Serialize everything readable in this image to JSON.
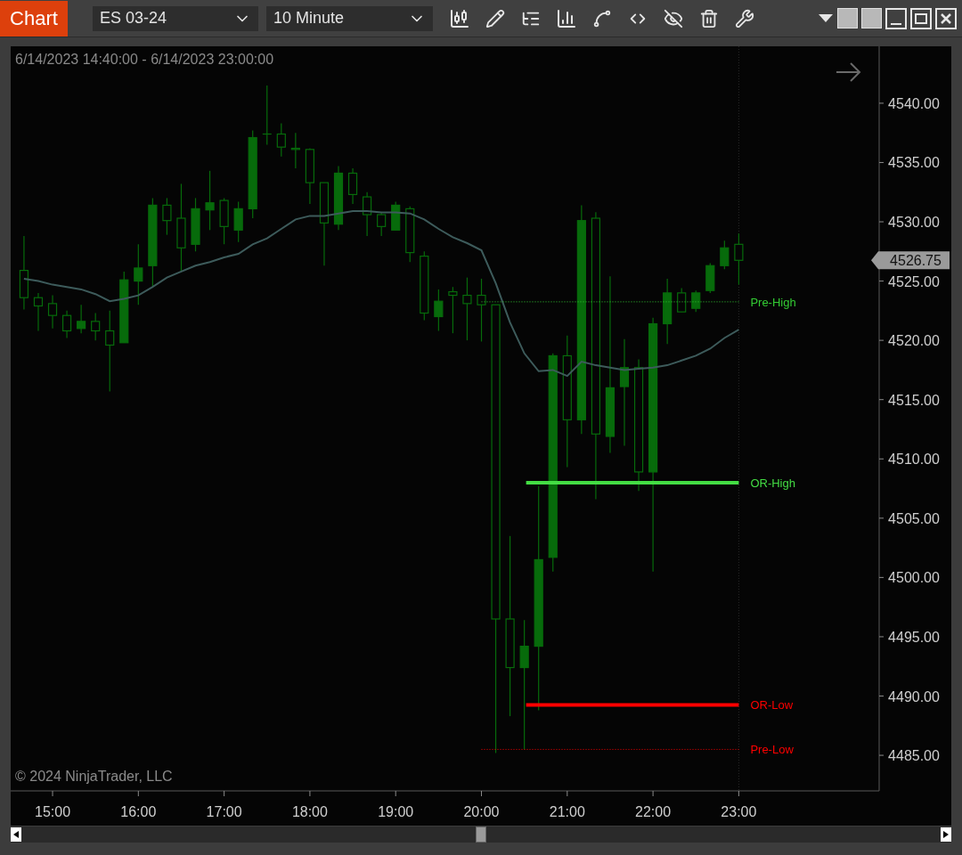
{
  "toolbar": {
    "title": "Chart",
    "instrument": "ES 03-24",
    "interval": "10 Minute"
  },
  "chart": {
    "date_range": "6/14/2023 14:40:00 - 6/14/2023 23:00:00",
    "copyright": "© 2024 NinjaTrader, LLC",
    "last_price": "4526.75",
    "chart_data": {
      "type": "candlestick",
      "x": [
        14.6667,
        14.8333,
        15,
        15.1667,
        15.3333,
        15.5,
        15.6667,
        15.8333,
        16,
        16.1667,
        16.3333,
        16.5,
        16.6667,
        16.8333,
        17,
        17.1667,
        17.3333,
        17.5,
        17.6667,
        17.8333,
        18,
        18.1667,
        18.3333,
        18.5,
        18.6667,
        18.8333,
        19,
        19.1667,
        19.3333,
        19.5,
        19.6667,
        19.8333,
        20,
        20.1667,
        20.3333,
        20.5,
        20.6667,
        20.8333,
        21,
        21.1667,
        21.3333,
        21.5,
        21.6667,
        21.8333,
        22,
        22.1667,
        22.3333,
        22.5,
        22.6667,
        22.8333,
        23
      ],
      "ohlc": [
        [
          4525.9,
          4528.8,
          4522.6,
          4523.6
        ],
        [
          4523.6,
          4524.0,
          4520.8,
          4522.9
        ],
        [
          4523.1,
          4523.8,
          4521.0,
          4522.1
        ],
        [
          4522.1,
          4522.5,
          4520.2,
          4520.8
        ],
        [
          4521.0,
          4523.0,
          4520.6,
          4521.6
        ],
        [
          4521.6,
          4522.3,
          4520.0,
          4520.8
        ],
        [
          4520.8,
          4522.5,
          4515.7,
          4519.6
        ],
        [
          4519.8,
          4525.8,
          4519.8,
          4525.1
        ],
        [
          4525.0,
          4528.1,
          4523.0,
          4526.1
        ],
        [
          4526.3,
          4532.0,
          4524.5,
          4531.4
        ],
        [
          4531.4,
          4532.0,
          4528.9,
          4530.1
        ],
        [
          4530.3,
          4533.2,
          4525.8,
          4527.8
        ],
        [
          4528.1,
          4532.0,
          4527.5,
          4531.1
        ],
        [
          4531.0,
          4534.3,
          4529.3,
          4531.6
        ],
        [
          4531.8,
          4532.0,
          4528.1,
          4529.6
        ],
        [
          4529.3,
          4531.7,
          4528.3,
          4531.1
        ],
        [
          4531.1,
          4537.7,
          4530.3,
          4537.1
        ],
        [
          4537.4,
          4541.5,
          4536.5,
          4537.4
        ],
        [
          4537.4,
          4538.3,
          4535.5,
          4536.3
        ],
        [
          4536.2,
          4537.5,
          4534.5,
          4536.1
        ],
        [
          4536.1,
          4536.2,
          4531.5,
          4533.3
        ],
        [
          4533.3,
          4533.3,
          4526.3,
          4529.9
        ],
        [
          4529.8,
          4534.7,
          4529.3,
          4534.1
        ],
        [
          4534.1,
          4534.5,
          4531.5,
          4532.3
        ],
        [
          4532.1,
          4532.5,
          4528.8,
          4530.6
        ],
        [
          4530.6,
          4530.8,
          4528.8,
          4529.6
        ],
        [
          4529.3,
          4531.7,
          4529.3,
          4531.4
        ],
        [
          4531.1,
          4531.3,
          4526.6,
          4527.4
        ],
        [
          4527.1,
          4527.5,
          4521.7,
          4522.3
        ],
        [
          4522.0,
          4524.3,
          4520.8,
          4523.3
        ],
        [
          4524.1,
          4524.5,
          4520.6,
          4523.8
        ],
        [
          4523.8,
          4525.3,
          4520.0,
          4523.1
        ],
        [
          4523.8,
          4525.2,
          4519.9,
          4523.0
        ],
        [
          4523.0,
          4523.0,
          4485.2,
          4496.5
        ],
        [
          4496.5,
          4503.5,
          4488.3,
          4492.4
        ],
        [
          4492.4,
          4496.4,
          4485.5,
          4494.2
        ],
        [
          4494.2,
          4507.7,
          4488.8,
          4501.5
        ],
        [
          4501.7,
          4518.9,
          4500.5,
          4518.7
        ],
        [
          4518.7,
          4520.4,
          4509.3,
          4513.3
        ],
        [
          4513.3,
          4531.4,
          4512.1,
          4530.1
        ],
        [
          4530.3,
          4530.8,
          4506.6,
          4512.1
        ],
        [
          4511.9,
          4525.4,
          4510.5,
          4516.0
        ],
        [
          4516.1,
          4520.1,
          4511.1,
          4517.7
        ],
        [
          4517.7,
          4518.4,
          4507.3,
          4508.9
        ],
        [
          4508.9,
          4521.9,
          4500.5,
          4521.4
        ],
        [
          4521.4,
          4525.2,
          4519.7,
          4524.0
        ],
        [
          4524.0,
          4524.4,
          4522.4,
          4522.4
        ],
        [
          4522.7,
          4524.2,
          4522.4,
          4524.0
        ],
        [
          4524.2,
          4526.5,
          4524.0,
          4526.3
        ],
        [
          4526.3,
          4528.4,
          4526.0,
          4527.8
        ],
        [
          4528.1,
          4529.0,
          4524.7,
          4526.75
        ]
      ],
      "series": [
        {
          "type": "line",
          "color": "#3d5b5b",
          "values": [
            4525.2,
            4525.0,
            4524.7,
            4524.5,
            4524.3,
            4523.9,
            4523.3,
            4523.5,
            4523.8,
            4524.5,
            4525.3,
            4525.8,
            4526.3,
            4526.6,
            4527.0,
            4527.3,
            4528.1,
            4528.6,
            4529.4,
            4530.2,
            4530.5,
            4530.5,
            4530.7,
            4530.9,
            4530.9,
            4530.8,
            4530.8,
            4530.7,
            4530.2,
            4529.4,
            4528.7,
            4528.2,
            4527.6,
            4524.8,
            4521.5,
            4518.9,
            4517.4,
            4517.5,
            4517.0,
            4518.2,
            4517.9,
            4517.7,
            4517.5,
            4517.6,
            4517.7,
            4517.9,
            4518.3,
            4518.7,
            4519.3,
            4520.2,
            4520.9
          ]
        }
      ],
      "xlim": [
        14.5117,
        24.6367
      ],
      "ylim": [
        4482.0,
        4544.8
      ],
      "xticks": [
        {
          "value": 15,
          "label": "15:00"
        },
        {
          "value": 16,
          "label": "16:00"
        },
        {
          "value": 17,
          "label": "17:00"
        },
        {
          "value": 18,
          "label": "18:00"
        },
        {
          "value": 19,
          "label": "19:00"
        },
        {
          "value": 20,
          "label": "20:00"
        },
        {
          "value": 21,
          "label": "21:00"
        },
        {
          "value": 22,
          "label": "22:00"
        },
        {
          "value": 23,
          "label": "23:00"
        }
      ],
      "yticks": [
        {
          "value": 4485,
          "label": "4485.00"
        },
        {
          "value": 4490,
          "label": "4490.00"
        },
        {
          "value": 4495,
          "label": "4495.00"
        },
        {
          "value": 4500,
          "label": "4500.00"
        },
        {
          "value": 4505,
          "label": "4505.00"
        },
        {
          "value": 4510,
          "label": "4510.00"
        },
        {
          "value": 4515,
          "label": "4515.00"
        },
        {
          "value": 4520,
          "label": "4520.00"
        },
        {
          "value": 4525,
          "label": "4525.00"
        },
        {
          "value": 4530,
          "label": "4530.00"
        },
        {
          "value": 4535,
          "label": "4535.00"
        },
        {
          "value": 4540,
          "label": "4540.00"
        }
      ],
      "ref_lines": [
        {
          "axis": "y",
          "value": 4523.25,
          "label": "Pre-High",
          "color": "#33cc33"
        },
        {
          "axis": "y",
          "value": 4508.0,
          "label": "OR-High",
          "color": "#44dd44"
        },
        {
          "axis": "y",
          "value": 4489.25,
          "label": "OR-Low",
          "color": "#ff0000"
        },
        {
          "axis": "y",
          "value": 4485.5,
          "label": "Pre-Low",
          "color": "#ff0000"
        }
      ]
    }
  }
}
